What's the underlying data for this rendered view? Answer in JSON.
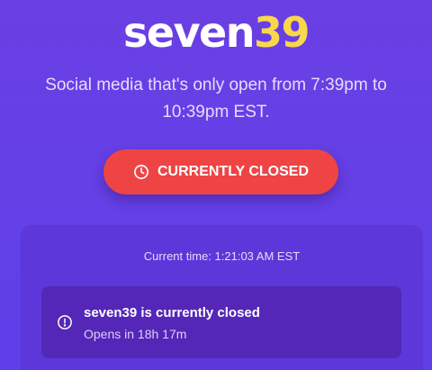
{
  "logo": {
    "part_a": "seven",
    "part_b": "39"
  },
  "tagline": "Social media that's only open from 7:39pm to 10:39pm EST.",
  "status_button": {
    "icon": "clock-icon",
    "label": "CURRENTLY CLOSED"
  },
  "panel": {
    "current_time": "Current time: 1:21:03 AM EST",
    "notice": {
      "icon": "info-circle-icon",
      "title": "seven39 is currently closed",
      "subtitle": "Opens in 18h 17m"
    }
  },
  "colors": {
    "background": "#6540e6",
    "accent_yellow": "#f7d84a",
    "status_red": "#ef4444",
    "notice_bg": "#5427b8"
  }
}
